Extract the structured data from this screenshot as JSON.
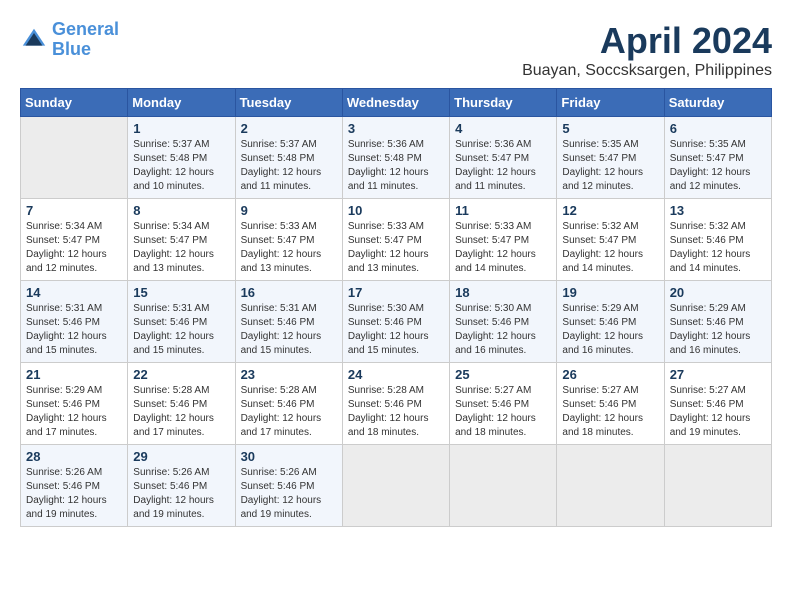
{
  "header": {
    "logo_line1": "General",
    "logo_line2": "Blue",
    "title": "April 2024",
    "subtitle": "Buayan, Soccsksargen, Philippines"
  },
  "weekdays": [
    "Sunday",
    "Monday",
    "Tuesday",
    "Wednesday",
    "Thursday",
    "Friday",
    "Saturday"
  ],
  "weeks": [
    [
      {
        "day": "",
        "info": ""
      },
      {
        "day": "1",
        "info": "Sunrise: 5:37 AM\nSunset: 5:48 PM\nDaylight: 12 hours\nand 10 minutes."
      },
      {
        "day": "2",
        "info": "Sunrise: 5:37 AM\nSunset: 5:48 PM\nDaylight: 12 hours\nand 11 minutes."
      },
      {
        "day": "3",
        "info": "Sunrise: 5:36 AM\nSunset: 5:48 PM\nDaylight: 12 hours\nand 11 minutes."
      },
      {
        "day": "4",
        "info": "Sunrise: 5:36 AM\nSunset: 5:47 PM\nDaylight: 12 hours\nand 11 minutes."
      },
      {
        "day": "5",
        "info": "Sunrise: 5:35 AM\nSunset: 5:47 PM\nDaylight: 12 hours\nand 12 minutes."
      },
      {
        "day": "6",
        "info": "Sunrise: 5:35 AM\nSunset: 5:47 PM\nDaylight: 12 hours\nand 12 minutes."
      }
    ],
    [
      {
        "day": "7",
        "info": "Sunrise: 5:34 AM\nSunset: 5:47 PM\nDaylight: 12 hours\nand 12 minutes."
      },
      {
        "day": "8",
        "info": "Sunrise: 5:34 AM\nSunset: 5:47 PM\nDaylight: 12 hours\nand 13 minutes."
      },
      {
        "day": "9",
        "info": "Sunrise: 5:33 AM\nSunset: 5:47 PM\nDaylight: 12 hours\nand 13 minutes."
      },
      {
        "day": "10",
        "info": "Sunrise: 5:33 AM\nSunset: 5:47 PM\nDaylight: 12 hours\nand 13 minutes."
      },
      {
        "day": "11",
        "info": "Sunrise: 5:33 AM\nSunset: 5:47 PM\nDaylight: 12 hours\nand 14 minutes."
      },
      {
        "day": "12",
        "info": "Sunrise: 5:32 AM\nSunset: 5:47 PM\nDaylight: 12 hours\nand 14 minutes."
      },
      {
        "day": "13",
        "info": "Sunrise: 5:32 AM\nSunset: 5:46 PM\nDaylight: 12 hours\nand 14 minutes."
      }
    ],
    [
      {
        "day": "14",
        "info": "Sunrise: 5:31 AM\nSunset: 5:46 PM\nDaylight: 12 hours\nand 15 minutes."
      },
      {
        "day": "15",
        "info": "Sunrise: 5:31 AM\nSunset: 5:46 PM\nDaylight: 12 hours\nand 15 minutes."
      },
      {
        "day": "16",
        "info": "Sunrise: 5:31 AM\nSunset: 5:46 PM\nDaylight: 12 hours\nand 15 minutes."
      },
      {
        "day": "17",
        "info": "Sunrise: 5:30 AM\nSunset: 5:46 PM\nDaylight: 12 hours\nand 15 minutes."
      },
      {
        "day": "18",
        "info": "Sunrise: 5:30 AM\nSunset: 5:46 PM\nDaylight: 12 hours\nand 16 minutes."
      },
      {
        "day": "19",
        "info": "Sunrise: 5:29 AM\nSunset: 5:46 PM\nDaylight: 12 hours\nand 16 minutes."
      },
      {
        "day": "20",
        "info": "Sunrise: 5:29 AM\nSunset: 5:46 PM\nDaylight: 12 hours\nand 16 minutes."
      }
    ],
    [
      {
        "day": "21",
        "info": "Sunrise: 5:29 AM\nSunset: 5:46 PM\nDaylight: 12 hours\nand 17 minutes."
      },
      {
        "day": "22",
        "info": "Sunrise: 5:28 AM\nSunset: 5:46 PM\nDaylight: 12 hours\nand 17 minutes."
      },
      {
        "day": "23",
        "info": "Sunrise: 5:28 AM\nSunset: 5:46 PM\nDaylight: 12 hours\nand 17 minutes."
      },
      {
        "day": "24",
        "info": "Sunrise: 5:28 AM\nSunset: 5:46 PM\nDaylight: 12 hours\nand 18 minutes."
      },
      {
        "day": "25",
        "info": "Sunrise: 5:27 AM\nSunset: 5:46 PM\nDaylight: 12 hours\nand 18 minutes."
      },
      {
        "day": "26",
        "info": "Sunrise: 5:27 AM\nSunset: 5:46 PM\nDaylight: 12 hours\nand 18 minutes."
      },
      {
        "day": "27",
        "info": "Sunrise: 5:27 AM\nSunset: 5:46 PM\nDaylight: 12 hours\nand 19 minutes."
      }
    ],
    [
      {
        "day": "28",
        "info": "Sunrise: 5:26 AM\nSunset: 5:46 PM\nDaylight: 12 hours\nand 19 minutes."
      },
      {
        "day": "29",
        "info": "Sunrise: 5:26 AM\nSunset: 5:46 PM\nDaylight: 12 hours\nand 19 minutes."
      },
      {
        "day": "30",
        "info": "Sunrise: 5:26 AM\nSunset: 5:46 PM\nDaylight: 12 hours\nand 19 minutes."
      },
      {
        "day": "",
        "info": ""
      },
      {
        "day": "",
        "info": ""
      },
      {
        "day": "",
        "info": ""
      },
      {
        "day": "",
        "info": ""
      }
    ]
  ]
}
